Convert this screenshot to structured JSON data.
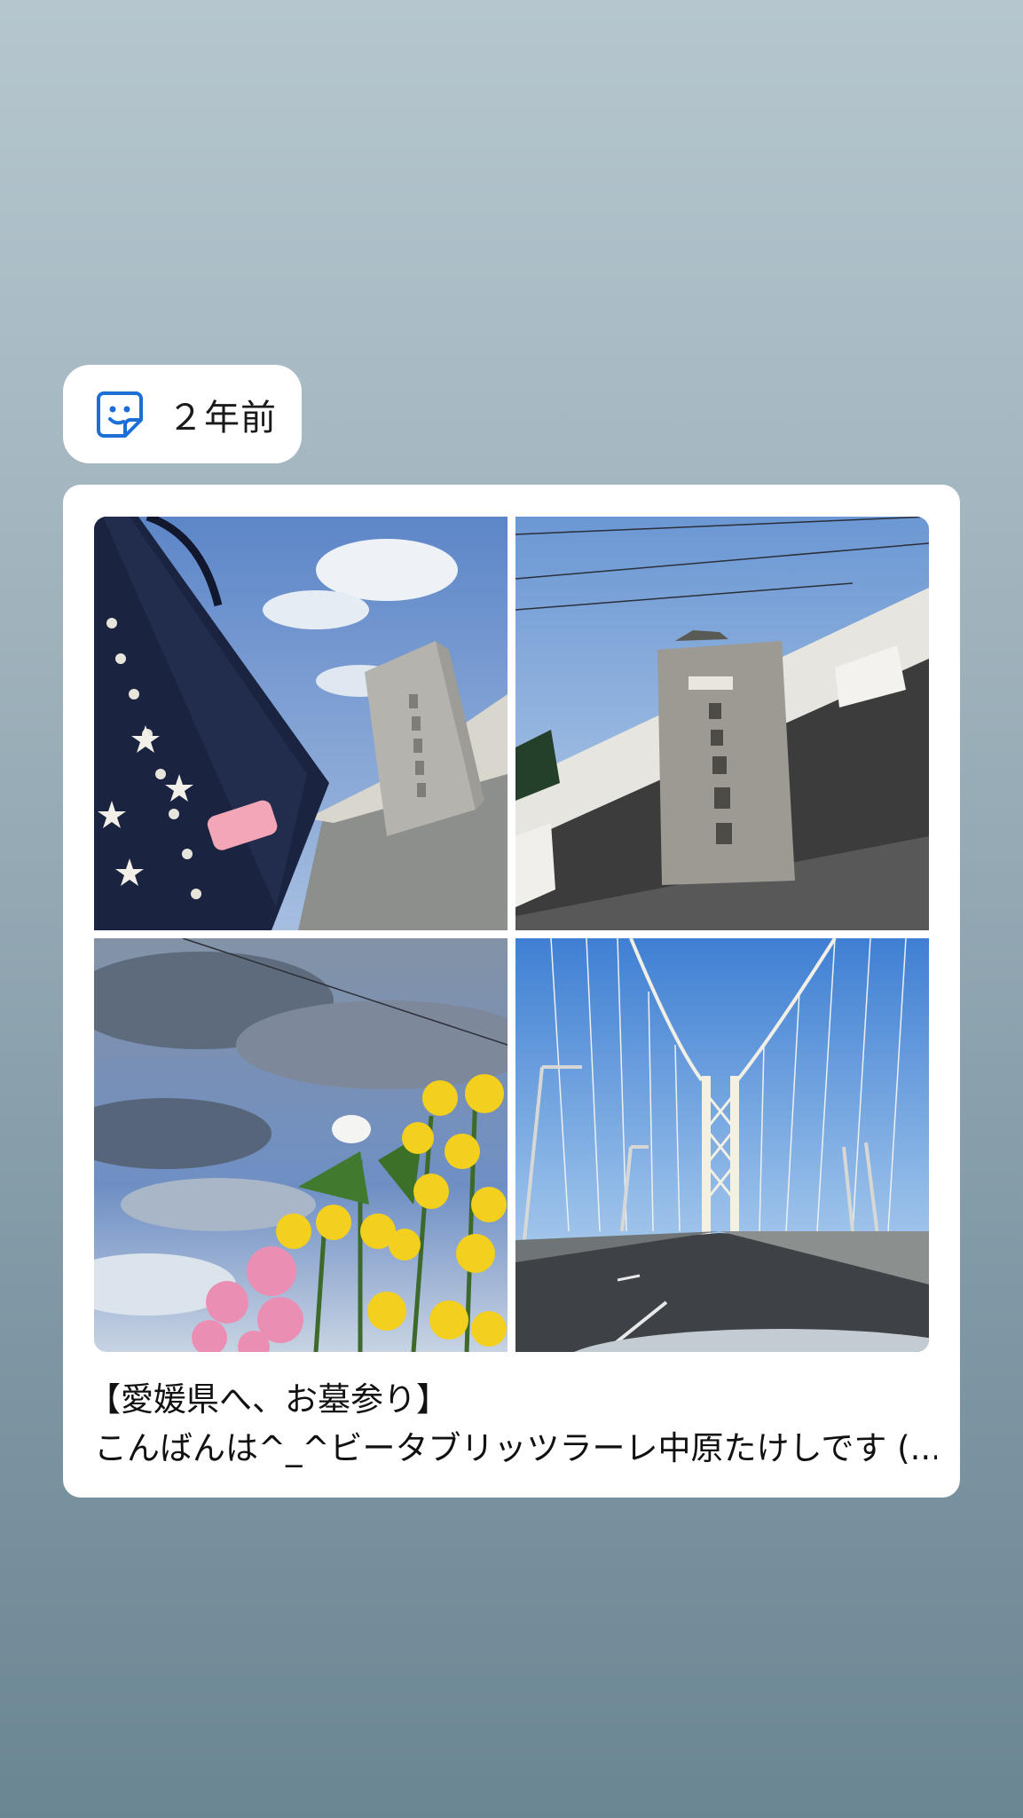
{
  "memory": {
    "icon": "sticker-face-icon",
    "time_ago": "２年前"
  },
  "post": {
    "photos": [
      {
        "name": "photo-tote-bag-stone-monument"
      },
      {
        "name": "photo-temple-stone-pillar"
      },
      {
        "name": "photo-flowers-sky"
      },
      {
        "name": "photo-suspension-bridge"
      }
    ],
    "title": "【愛媛県へ、お墓参り】",
    "excerpt": "こんばんは^_^ビータブリッツラーレ中原たけしです (..."
  },
  "colors": {
    "background_top": "#b5c6ce",
    "background_bottom": "#6b8693",
    "card": "#ffffff",
    "icon_blue": "#1b6fd6"
  }
}
